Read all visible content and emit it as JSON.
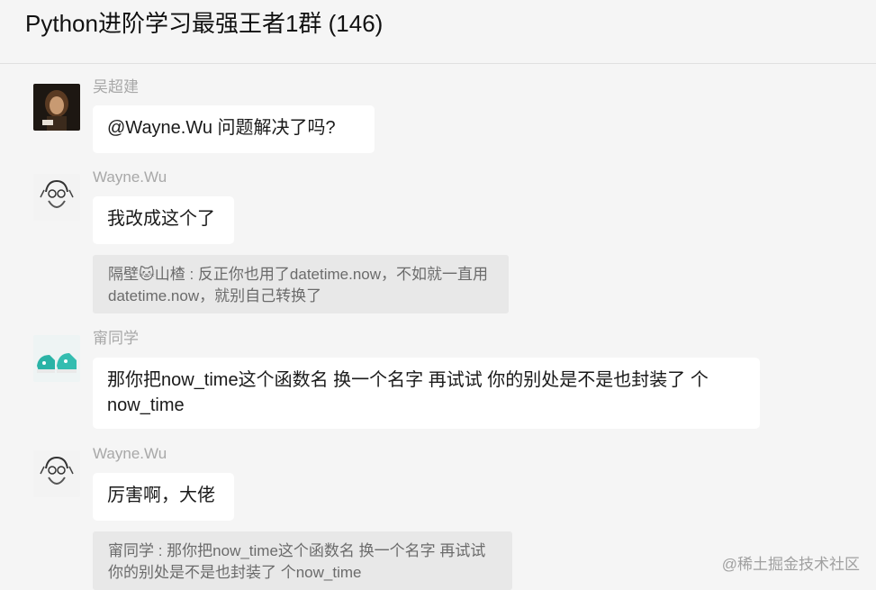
{
  "header": {
    "title": "Python进阶学习最强王者1群 (146)"
  },
  "messages": [
    {
      "sender": "吴超建",
      "text": "@Wayne.Wu 问题解决了吗?"
    },
    {
      "sender": "Wayne.Wu",
      "text": "我改成这个了",
      "quote": {
        "author": "隔壁🐱山楂",
        "sep": " : ",
        "text": "反正你也用了datetime.now，不如就一直用datetime.now，就别自己转换了"
      }
    },
    {
      "sender": "甯同学",
      "text": "那你把now_time这个函数名 换一个名字 再试试 你的别处是不是也封装了 个now_time"
    },
    {
      "sender": "Wayne.Wu",
      "text": "厉害啊，大佬",
      "quote": {
        "author": "甯同学",
        "sep": " : ",
        "text": "那你把now_time这个函数名 换一个名字 再试试 你的别处是不是也封装了 个now_time"
      }
    }
  ],
  "avatars": {
    "wu": "photo-avatar-icon",
    "wayne": "sketch-portrait-icon",
    "ning": "shoes-avatar-icon"
  },
  "watermark": "@稀土掘金技术社区"
}
